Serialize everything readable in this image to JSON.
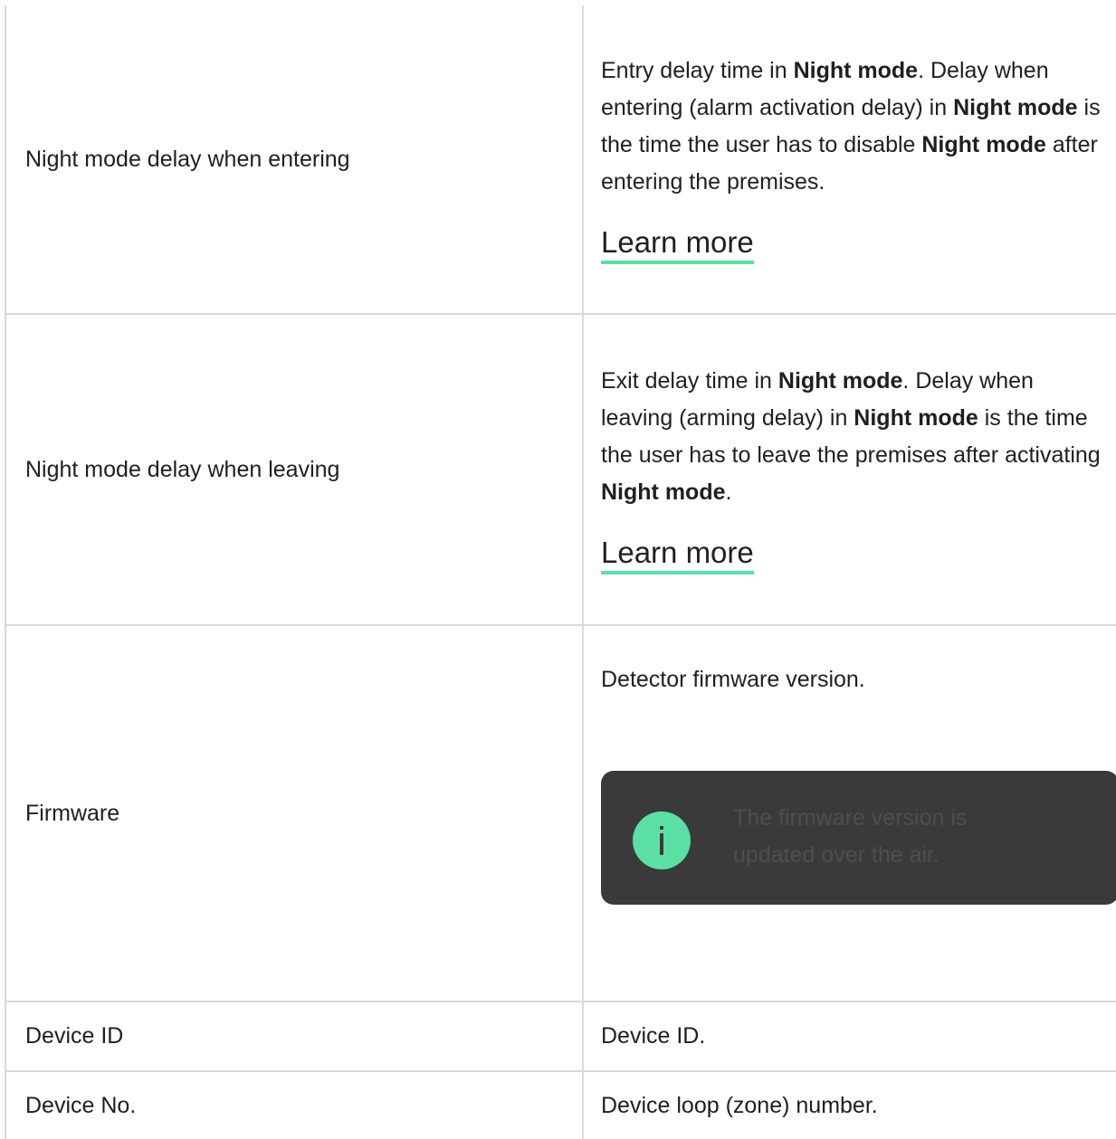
{
  "rows": [
    {
      "name": "Night mode delay when entering",
      "desc_parts": [
        "Entry delay time in ",
        "Night mode",
        ". Delay when entering (alarm activation delay) in ",
        "Night mode",
        " is the time the user has to disable ",
        "Night mode",
        " after entering the premises."
      ],
      "link": "Learn more"
    },
    {
      "name": "Night mode delay when leaving",
      "desc_parts": [
        "Exit delay time in ",
        "Night mode",
        ". Delay when leaving (arming delay) in ",
        "Night mode",
        " is the time the user has to leave the premises after activating ",
        "Night mode",
        "."
      ],
      "link": "Learn more"
    },
    {
      "name": "Firmware",
      "desc": "Detector firmware version.",
      "note": {
        "icon": "info-icon",
        "text": "The firmware version is updated over the air."
      }
    },
    {
      "name": "Device ID",
      "desc": "Device ID."
    },
    {
      "name": "Device No.",
      "desc": "Device loop (zone) number."
    }
  ],
  "colors": {
    "accent": "#5be0a3",
    "note_bg": "#3a3a3a",
    "border": "#d9d9d9"
  }
}
